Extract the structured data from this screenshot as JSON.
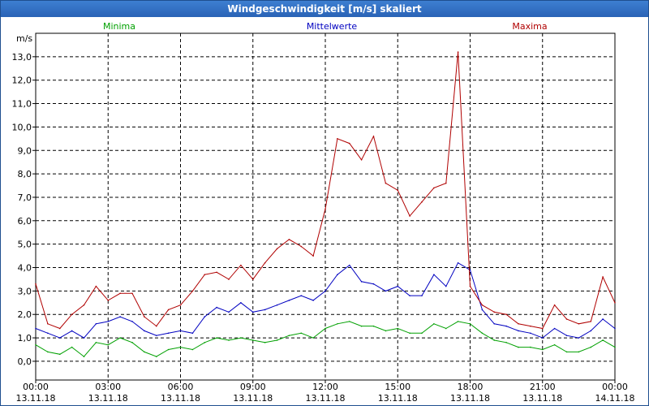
{
  "window": {
    "title": "Windgeschwindigkeit [m/s] skaliert"
  },
  "chart_data": {
    "type": "line",
    "title": "Windgeschwindigkeit [m/s] skaliert",
    "ylabel": "m/s",
    "ylim": [
      -0.8,
      14.0
    ],
    "xlim": [
      0,
      24
    ],
    "grid": true,
    "legend_placement": "top",
    "y_ticks": [
      "0,0",
      "1,0",
      "2,0",
      "3,0",
      "4,0",
      "5,0",
      "6,0",
      "7,0",
      "8,0",
      "9,0",
      "10,0",
      "11,0",
      "12,0",
      "13,0"
    ],
    "x_ticks": [
      {
        "time": "00:00",
        "date": "13.11.18"
      },
      {
        "time": "03:00",
        "date": "13.11.18"
      },
      {
        "time": "06:00",
        "date": "13.11.18"
      },
      {
        "time": "09:00",
        "date": "13.11.18"
      },
      {
        "time": "12:00",
        "date": "13.11.18"
      },
      {
        "time": "15:00",
        "date": "13.11.18"
      },
      {
        "time": "18:00",
        "date": "13.11.18"
      },
      {
        "time": "21:00",
        "date": "13.11.18"
      },
      {
        "time": "00:00",
        "date": "14.11.18"
      }
    ],
    "x_hours": [
      0,
      0.5,
      1,
      1.5,
      2,
      2.5,
      3,
      3.5,
      4,
      4.5,
      5,
      5.5,
      6,
      6.5,
      7,
      7.5,
      8,
      8.5,
      9,
      9.5,
      10,
      10.5,
      11,
      11.5,
      12,
      12.5,
      13,
      13.5,
      14,
      14.5,
      15,
      15.5,
      16,
      16.5,
      17,
      17.5,
      18,
      18.5,
      19,
      19.5,
      20,
      20.5,
      21,
      21.5,
      22,
      22.5,
      23,
      23.5,
      24
    ],
    "series": [
      {
        "name": "Minima",
        "color": "#00a000",
        "values": [
          0.7,
          0.4,
          0.3,
          0.6,
          0.2,
          0.8,
          0.7,
          1.0,
          0.8,
          0.4,
          0.2,
          0.5,
          0.6,
          0.5,
          0.8,
          1.0,
          0.9,
          1.0,
          0.9,
          0.8,
          0.9,
          1.1,
          1.2,
          1.0,
          1.4,
          1.6,
          1.7,
          1.5,
          1.5,
          1.3,
          1.4,
          1.2,
          1.2,
          1.6,
          1.4,
          1.7,
          1.6,
          1.2,
          0.9,
          0.8,
          0.6,
          0.6,
          0.5,
          0.7,
          0.4,
          0.4,
          0.6,
          0.9,
          0.6
        ]
      },
      {
        "name": "Mittelwerte",
        "color": "#0000c0",
        "values": [
          1.4,
          1.2,
          1.0,
          1.3,
          1.0,
          1.6,
          1.7,
          1.9,
          1.7,
          1.3,
          1.1,
          1.2,
          1.3,
          1.2,
          1.9,
          2.3,
          2.1,
          2.5,
          2.1,
          2.2,
          2.4,
          2.6,
          2.8,
          2.6,
          3.0,
          3.7,
          4.1,
          3.4,
          3.3,
          3.0,
          3.2,
          2.8,
          2.8,
          3.7,
          3.2,
          4.2,
          3.9,
          2.2,
          1.6,
          1.5,
          1.3,
          1.2,
          1.0,
          1.4,
          1.1,
          1.0,
          1.3,
          1.8,
          1.4
        ]
      },
      {
        "name": "Maxima",
        "color": "#b00000",
        "values": [
          3.3,
          1.6,
          1.4,
          2.0,
          2.4,
          3.2,
          2.6,
          2.9,
          2.9,
          1.9,
          1.5,
          2.2,
          2.4,
          3.0,
          3.7,
          3.8,
          3.5,
          4.1,
          3.5,
          4.2,
          4.8,
          5.2,
          4.9,
          4.5,
          6.5,
          9.5,
          9.3,
          8.6,
          9.6,
          7.6,
          7.3,
          6.2,
          6.8,
          7.4,
          7.6,
          13.2,
          3.2,
          2.4,
          2.1,
          2.0,
          1.6,
          1.5,
          1.4,
          2.4,
          1.8,
          1.6,
          1.7,
          3.6,
          2.5
        ]
      }
    ]
  }
}
